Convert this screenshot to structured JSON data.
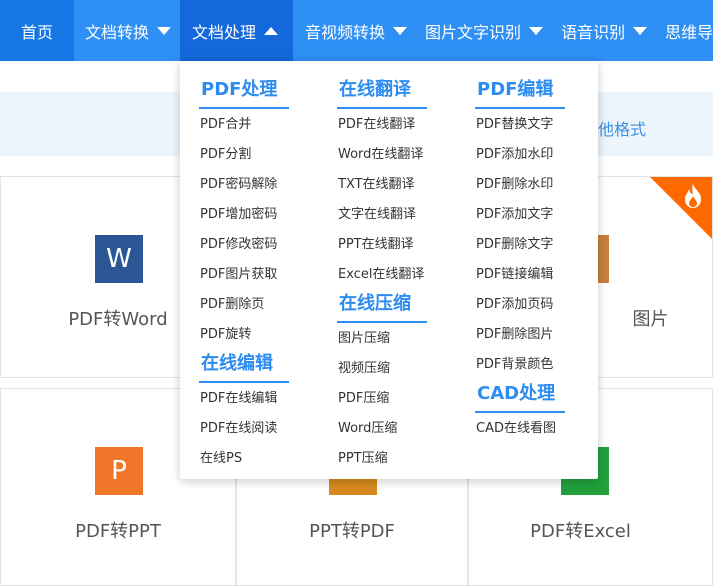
{
  "nav": {
    "items": [
      "首页",
      "文档转换",
      "文档处理",
      "音视频转换",
      "图片文字识别",
      "语音识别",
      "思维导图"
    ]
  },
  "banner": {
    "text": "他格式"
  },
  "cards": [
    {
      "label": "PDF转Word",
      "icon": "W"
    },
    {
      "label": "图片",
      "icon": ""
    },
    {
      "label": "PDF转PPT",
      "icon": "P"
    },
    {
      "label": "PPT转PDF",
      "icon": ""
    },
    {
      "label": "PDF转Excel",
      "icon": ""
    }
  ],
  "dropdown": {
    "pdf_process": {
      "title": "PDF处理",
      "items": [
        "PDF合并",
        "PDF分割",
        "PDF密码解除",
        "PDF增加密码",
        "PDF修改密码",
        "PDF图片获取",
        "PDF删除页",
        "PDF旋转"
      ]
    },
    "online_edit": {
      "title": "在线编辑",
      "items": [
        "PDF在线编辑",
        "PDF在线阅读",
        "在线PS"
      ]
    },
    "online_translate": {
      "title": "在线翻译",
      "items": [
        "PDF在线翻译",
        "Word在线翻译",
        "TXT在线翻译",
        "文字在线翻译",
        "PPT在线翻译",
        "Excel在线翻译"
      ]
    },
    "online_compress": {
      "title": "在线压缩",
      "items": [
        "图片压缩",
        "视频压缩",
        "PDF压缩",
        "Word压缩",
        "PPT压缩"
      ]
    },
    "pdf_edit": {
      "title": "PDF编辑",
      "items": [
        "PDF替换文字",
        "PDF添加水印",
        "PDF删除水印",
        "PDF添加文字",
        "PDF删除文字",
        "PDF链接编辑",
        "PDF添加页码",
        "PDF删除图片",
        "PDF背景颜色"
      ]
    },
    "cad": {
      "title": "CAD处理",
      "items": [
        "CAD在线看图"
      ]
    }
  },
  "colors": {
    "nav_bg": "#2e8ff4",
    "nav_active": "#1368db",
    "accent": "#2d8cf0",
    "badge": "#ff6a00"
  }
}
